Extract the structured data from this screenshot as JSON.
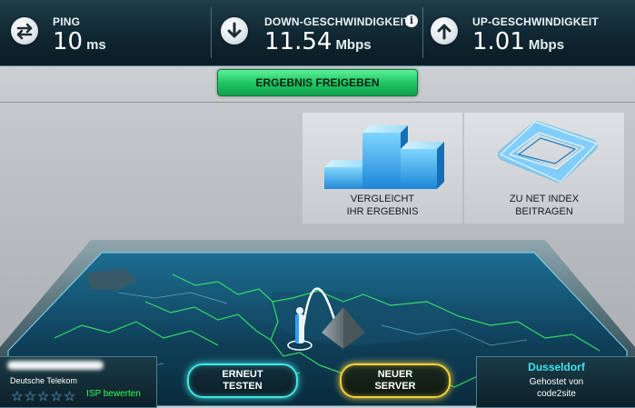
{
  "header": {
    "ping": {
      "label": "PING",
      "value": "10",
      "unit": "ms",
      "icon": "ping-arrows-icon"
    },
    "download": {
      "label": "DOWN-GESCHWINDIGKEIT",
      "value": "11.54",
      "unit": "Mbps",
      "icon": "download-arrow-icon",
      "info_icon": "info-icon"
    },
    "upload": {
      "label": "UP-GESCHWINDIGKEIT",
      "value": "1.01",
      "unit": "Mbps",
      "icon": "upload-arrow-icon"
    }
  },
  "share_button": {
    "label": "ERGEBNIS FREIGEBEN"
  },
  "panels": {
    "compare": {
      "line1": "VERGLEICHT",
      "line2": "IHR ERGEBNIS",
      "icon": "bar-chart-icon"
    },
    "netindex": {
      "line1": "ZU NET INDEX",
      "line2": "BEITRAGEN",
      "icon": "net-index-ring-icon"
    }
  },
  "isp": {
    "name": "Deutsche Telekom",
    "rating": 0,
    "max_rating": 5,
    "rate_label": "ISP bewerten"
  },
  "buttons": {
    "retest": {
      "line1": "ERNEUT",
      "line2": "TESTEN"
    },
    "new_server": {
      "line1": "NEUER",
      "line2": "SERVER"
    }
  },
  "server": {
    "city": "Dusseldorf",
    "hosted_by": "Gehostet von",
    "host": "code2site"
  },
  "colors": {
    "header_bg": "#0f2530",
    "accent_cyan": "#3be5ef",
    "share_green": "#1fc762",
    "retest_glow": "#44e6e2",
    "new_server_glow": "#f3d13c",
    "isp_rate_green": "#2fff57"
  }
}
